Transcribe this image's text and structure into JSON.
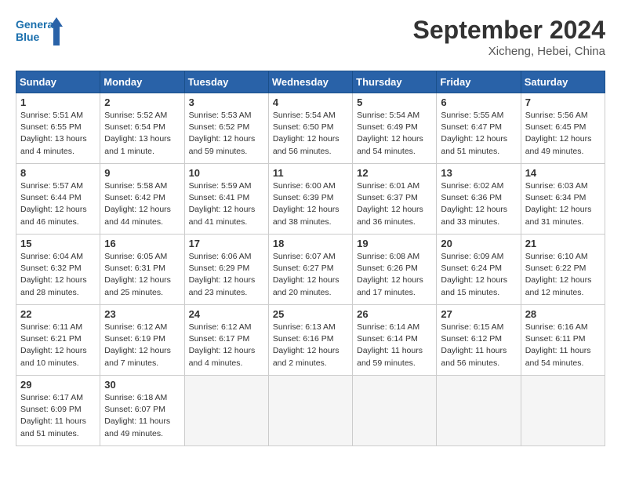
{
  "header": {
    "logo_line1": "General",
    "logo_line2": "Blue",
    "month": "September 2024",
    "location": "Xicheng, Hebei, China"
  },
  "weekdays": [
    "Sunday",
    "Monday",
    "Tuesday",
    "Wednesday",
    "Thursday",
    "Friday",
    "Saturday"
  ],
  "weeks": [
    [
      {
        "day": "1",
        "info": "Sunrise: 5:51 AM\nSunset: 6:55 PM\nDaylight: 13 hours\nand 4 minutes."
      },
      {
        "day": "2",
        "info": "Sunrise: 5:52 AM\nSunset: 6:54 PM\nDaylight: 13 hours\nand 1 minute."
      },
      {
        "day": "3",
        "info": "Sunrise: 5:53 AM\nSunset: 6:52 PM\nDaylight: 12 hours\nand 59 minutes."
      },
      {
        "day": "4",
        "info": "Sunrise: 5:54 AM\nSunset: 6:50 PM\nDaylight: 12 hours\nand 56 minutes."
      },
      {
        "day": "5",
        "info": "Sunrise: 5:54 AM\nSunset: 6:49 PM\nDaylight: 12 hours\nand 54 minutes."
      },
      {
        "day": "6",
        "info": "Sunrise: 5:55 AM\nSunset: 6:47 PM\nDaylight: 12 hours\nand 51 minutes."
      },
      {
        "day": "7",
        "info": "Sunrise: 5:56 AM\nSunset: 6:45 PM\nDaylight: 12 hours\nand 49 minutes."
      }
    ],
    [
      {
        "day": "8",
        "info": "Sunrise: 5:57 AM\nSunset: 6:44 PM\nDaylight: 12 hours\nand 46 minutes."
      },
      {
        "day": "9",
        "info": "Sunrise: 5:58 AM\nSunset: 6:42 PM\nDaylight: 12 hours\nand 44 minutes."
      },
      {
        "day": "10",
        "info": "Sunrise: 5:59 AM\nSunset: 6:41 PM\nDaylight: 12 hours\nand 41 minutes."
      },
      {
        "day": "11",
        "info": "Sunrise: 6:00 AM\nSunset: 6:39 PM\nDaylight: 12 hours\nand 38 minutes."
      },
      {
        "day": "12",
        "info": "Sunrise: 6:01 AM\nSunset: 6:37 PM\nDaylight: 12 hours\nand 36 minutes."
      },
      {
        "day": "13",
        "info": "Sunrise: 6:02 AM\nSunset: 6:36 PM\nDaylight: 12 hours\nand 33 minutes."
      },
      {
        "day": "14",
        "info": "Sunrise: 6:03 AM\nSunset: 6:34 PM\nDaylight: 12 hours\nand 31 minutes."
      }
    ],
    [
      {
        "day": "15",
        "info": "Sunrise: 6:04 AM\nSunset: 6:32 PM\nDaylight: 12 hours\nand 28 minutes."
      },
      {
        "day": "16",
        "info": "Sunrise: 6:05 AM\nSunset: 6:31 PM\nDaylight: 12 hours\nand 25 minutes."
      },
      {
        "day": "17",
        "info": "Sunrise: 6:06 AM\nSunset: 6:29 PM\nDaylight: 12 hours\nand 23 minutes."
      },
      {
        "day": "18",
        "info": "Sunrise: 6:07 AM\nSunset: 6:27 PM\nDaylight: 12 hours\nand 20 minutes."
      },
      {
        "day": "19",
        "info": "Sunrise: 6:08 AM\nSunset: 6:26 PM\nDaylight: 12 hours\nand 17 minutes."
      },
      {
        "day": "20",
        "info": "Sunrise: 6:09 AM\nSunset: 6:24 PM\nDaylight: 12 hours\nand 15 minutes."
      },
      {
        "day": "21",
        "info": "Sunrise: 6:10 AM\nSunset: 6:22 PM\nDaylight: 12 hours\nand 12 minutes."
      }
    ],
    [
      {
        "day": "22",
        "info": "Sunrise: 6:11 AM\nSunset: 6:21 PM\nDaylight: 12 hours\nand 10 minutes."
      },
      {
        "day": "23",
        "info": "Sunrise: 6:12 AM\nSunset: 6:19 PM\nDaylight: 12 hours\nand 7 minutes."
      },
      {
        "day": "24",
        "info": "Sunrise: 6:12 AM\nSunset: 6:17 PM\nDaylight: 12 hours\nand 4 minutes."
      },
      {
        "day": "25",
        "info": "Sunrise: 6:13 AM\nSunset: 6:16 PM\nDaylight: 12 hours\nand 2 minutes."
      },
      {
        "day": "26",
        "info": "Sunrise: 6:14 AM\nSunset: 6:14 PM\nDaylight: 11 hours\nand 59 minutes."
      },
      {
        "day": "27",
        "info": "Sunrise: 6:15 AM\nSunset: 6:12 PM\nDaylight: 11 hours\nand 56 minutes."
      },
      {
        "day": "28",
        "info": "Sunrise: 6:16 AM\nSunset: 6:11 PM\nDaylight: 11 hours\nand 54 minutes."
      }
    ],
    [
      {
        "day": "29",
        "info": "Sunrise: 6:17 AM\nSunset: 6:09 PM\nDaylight: 11 hours\nand 51 minutes."
      },
      {
        "day": "30",
        "info": "Sunrise: 6:18 AM\nSunset: 6:07 PM\nDaylight: 11 hours\nand 49 minutes."
      },
      {
        "day": "",
        "info": ""
      },
      {
        "day": "",
        "info": ""
      },
      {
        "day": "",
        "info": ""
      },
      {
        "day": "",
        "info": ""
      },
      {
        "day": "",
        "info": ""
      }
    ]
  ]
}
